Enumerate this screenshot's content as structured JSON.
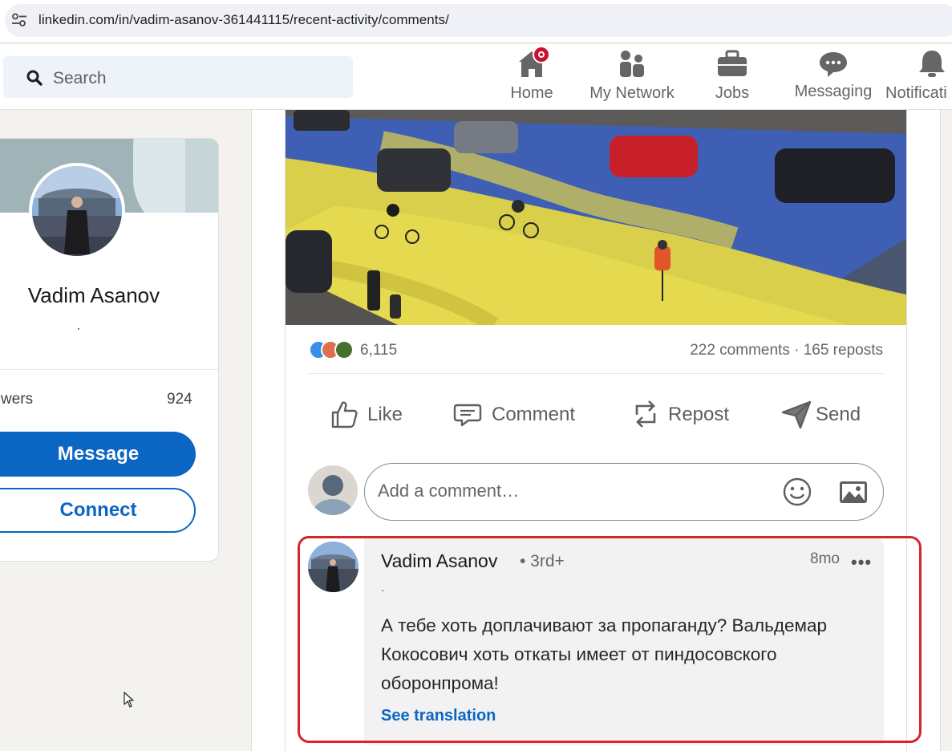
{
  "browser": {
    "url": "linkedin.com/in/vadim-asanov-361441115/recent-activity/comments/"
  },
  "nav": {
    "search_placeholder": "Search",
    "items": [
      {
        "label": "Home",
        "icon": "home-icon",
        "has_badge": true
      },
      {
        "label": "My Network",
        "icon": "people-icon"
      },
      {
        "label": "Jobs",
        "icon": "briefcase-icon"
      },
      {
        "label": "Messaging",
        "icon": "chat-bubble-icon"
      },
      {
        "label": "Notificati",
        "icon": "bell-icon"
      }
    ]
  },
  "profile": {
    "name": "Vadim Asanov",
    "headline": "·",
    "stat_label": "wers",
    "stat_value": "924",
    "message_label": "Message",
    "connect_label": "Connect"
  },
  "post": {
    "reaction_icons": [
      "like-reaction-icon",
      "love-reaction-icon",
      "support-reaction-icon"
    ],
    "reaction_count": "6,115",
    "comments_reposts": "222 comments · 165 reposts",
    "actions": [
      {
        "label": "Like",
        "icon": "thumbs-up-icon"
      },
      {
        "label": "Comment",
        "icon": "comment-icon"
      },
      {
        "label": "Repost",
        "icon": "repost-icon"
      },
      {
        "label": "Send",
        "icon": "send-icon"
      }
    ],
    "composer_placeholder": "Add a comment…"
  },
  "comment": {
    "author": "Vadim Asanov",
    "degree": "• 3rd+",
    "time": "8mo",
    "more": "•••",
    "subtitle": ".",
    "text": "А тебе хоть доплачивают за пропаганду? Вальдемар Кокосович хоть откаты имеет от пиндосовского оборонпрома!",
    "translate_label": "See translation"
  },
  "colors": {
    "brand_blue": "#0a66c2",
    "highlight_red": "#d6262d",
    "badge_red": "#cb112d"
  }
}
